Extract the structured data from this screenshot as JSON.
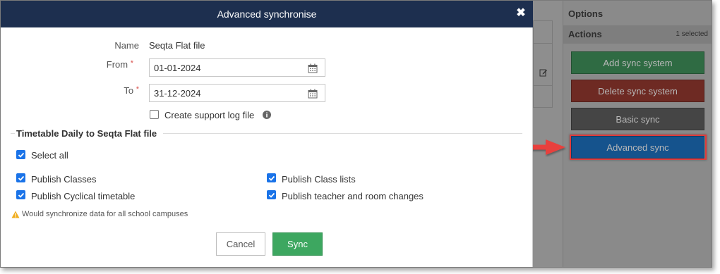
{
  "modal": {
    "title": "Advanced synchronise",
    "close_icon": "close-icon",
    "fields": {
      "name_label": "Name",
      "name_value": "Seqta Flat file",
      "from_label": "From",
      "from_value": "01-01-2024",
      "to_label": "To",
      "to_value": "31-12-2024",
      "required_marker": "*"
    },
    "support_log": {
      "label": "Create support log file",
      "checked": false
    },
    "section_title": "Timetable Daily to Seqta Flat file",
    "select_all": {
      "label": "Select all",
      "checked": true
    },
    "options": [
      {
        "label": "Publish Classes",
        "checked": true
      },
      {
        "label": "Publish Class lists",
        "checked": true
      },
      {
        "label": "Publish Cyclical timetable",
        "checked": true
      },
      {
        "label": "Publish teacher and room changes",
        "checked": true
      }
    ],
    "warning": "Would synchronize data for all school campuses",
    "buttons": {
      "cancel": "Cancel",
      "sync": "Sync"
    }
  },
  "options_panel": {
    "title": "Options",
    "actions_title": "Actions",
    "selected_count": "1 selected",
    "actions": [
      {
        "label": "Add sync system"
      },
      {
        "label": "Delete sync system"
      },
      {
        "label": "Basic sync"
      },
      {
        "label": "Advanced sync"
      }
    ]
  },
  "colors": {
    "header_bg": "#1d2f4f",
    "sync_green": "#3da760",
    "checkbox_blue": "#1a73e8",
    "highlight_red": "#e03c3c"
  }
}
